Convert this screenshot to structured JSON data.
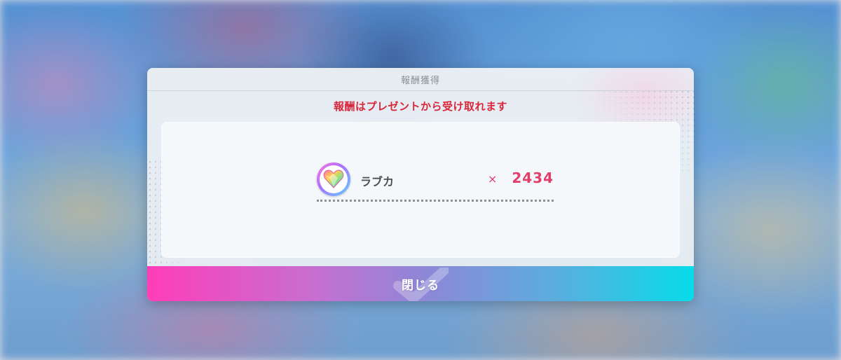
{
  "dialog": {
    "title": "報酬獲得",
    "notice": "報酬はプレゼントから受け取れます",
    "reward": {
      "name": "ラブカ",
      "multiplier": "×",
      "quantity": "2434",
      "icon": "heart-gem-icon"
    },
    "close_label": "閉じる"
  },
  "colors": {
    "notice_text": "#d9263a",
    "quantity_text": "#e0406a",
    "button_gradient_start": "#ff3db8",
    "button_gradient_end": "#07dcea"
  }
}
